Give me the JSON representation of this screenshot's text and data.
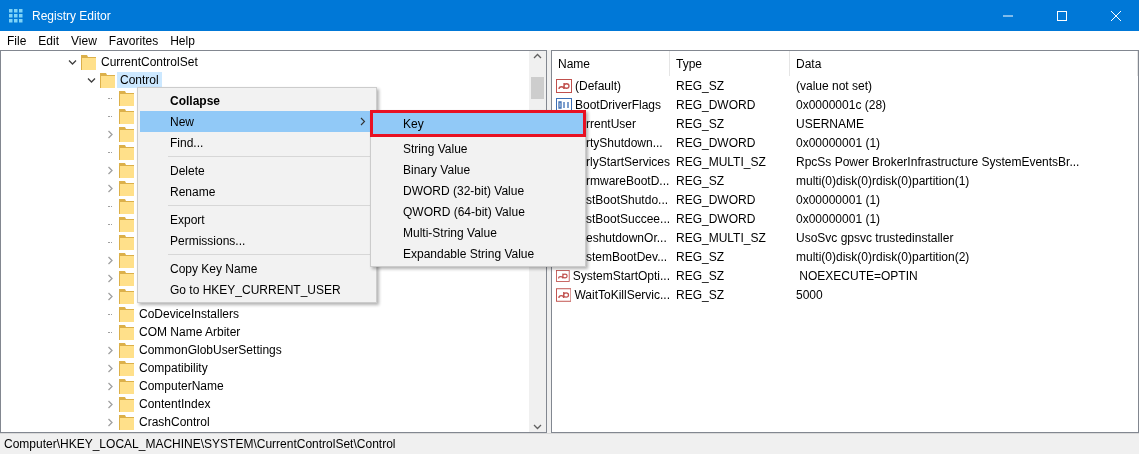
{
  "window": {
    "title": "Registry Editor"
  },
  "menu_bar": [
    "File",
    "Edit",
    "View",
    "Favorites",
    "Help"
  ],
  "tree": [
    {
      "label": "CurrentControlSet",
      "expanded": true,
      "selected": false,
      "children": [
        {
          "label": "Control",
          "expanded": true,
          "selected": true,
          "children": [
            {
              "expandable": false
            },
            {
              "expandable": false
            },
            {
              "expandable": true
            },
            {
              "expandable": false
            },
            {
              "expandable": true
            },
            {
              "expandable": true
            },
            {
              "expandable": false
            },
            {
              "expandable": false
            },
            {
              "expandable": false
            },
            {
              "expandable": true
            },
            {
              "expandable": true
            },
            {
              "expandable": true
            },
            {
              "label": "CoDeviceInstallers",
              "expandable": false
            },
            {
              "label": "COM Name Arbiter",
              "expandable": false
            },
            {
              "label": "CommonGlobUserSettings",
              "expandable": true
            },
            {
              "label": "Compatibility",
              "expandable": true
            },
            {
              "label": "ComputerName",
              "expandable": true
            },
            {
              "label": "ContentIndex",
              "expandable": true
            },
            {
              "label": "CrashControl",
              "expandable": true
            }
          ]
        }
      ]
    }
  ],
  "values": {
    "columns": [
      "Name",
      "Type",
      "Data"
    ],
    "rows": [
      {
        "name": "(Default)",
        "kind": "string",
        "covered": false,
        "type": "REG_SZ",
        "data": "(value not set)"
      },
      {
        "name": "BootDriverFlags",
        "kind": "binary",
        "covered": false,
        "type": "REG_DWORD",
        "data": "0x0000001c (28)"
      },
      {
        "name": "rrentUser",
        "covered": true,
        "type": "REG_SZ",
        "data": "USERNAME"
      },
      {
        "name": "rtyShutdown...",
        "covered": true,
        "type": "REG_DWORD",
        "data": "0x00000001 (1)"
      },
      {
        "name": "rlyStartServices",
        "covered": true,
        "type": "REG_MULTI_SZ",
        "data": "RpcSs Power BrokerInfrastructure SystemEventsBr..."
      },
      {
        "name": "rmwareBootD...",
        "covered": true,
        "type": "REG_SZ",
        "data": "multi(0)disk(0)rdisk(0)partition(1)"
      },
      {
        "name": "stBootShutdo...",
        "covered": true,
        "type": "REG_DWORD",
        "data": "0x00000001 (1)"
      },
      {
        "name": "stBootSuccee...",
        "covered": true,
        "type": "REG_DWORD",
        "data": "0x00000001 (1)"
      },
      {
        "name": "eshutdownOr...",
        "covered": true,
        "type": "REG_MULTI_SZ",
        "data": "UsoSvc gpsvc trustedinstaller"
      },
      {
        "name": "stemBootDev...",
        "covered": true,
        "type": "REG_SZ",
        "data": "multi(0)disk(0)rdisk(0)partition(2)"
      },
      {
        "name": "SystemStartOpti...",
        "kind": "string",
        "covered": false,
        "type": "REG_SZ",
        "data": " NOEXECUTE=OPTIN"
      },
      {
        "name": "WaitToKillServic...",
        "kind": "string",
        "covered": false,
        "type": "REG_SZ",
        "data": "5000"
      }
    ]
  },
  "context_menu": [
    {
      "kind": "item",
      "label": "Collapse",
      "default": true,
      "selected": false
    },
    {
      "kind": "item",
      "label": "New",
      "submenu": true,
      "selected": true
    },
    {
      "kind": "item",
      "label": "Find...",
      "selected": false
    },
    {
      "kind": "separator"
    },
    {
      "kind": "item",
      "label": "Delete",
      "selected": false
    },
    {
      "kind": "item",
      "label": "Rename",
      "selected": false
    },
    {
      "kind": "separator"
    },
    {
      "kind": "item",
      "label": "Export",
      "selected": false
    },
    {
      "kind": "item",
      "label": "Permissions...",
      "selected": false
    },
    {
      "kind": "separator"
    },
    {
      "kind": "item",
      "label": "Copy Key Name",
      "selected": false
    },
    {
      "kind": "item",
      "label": "Go to HKEY_CURRENT_USER",
      "selected": false
    }
  ],
  "submenu": [
    {
      "kind": "item",
      "label": "Key",
      "selected": true,
      "outlined": true
    },
    {
      "kind": "separator"
    },
    {
      "kind": "item",
      "label": "String Value",
      "selected": false,
      "outlined": false
    },
    {
      "kind": "item",
      "label": "Binary Value",
      "selected": false,
      "outlined": false
    },
    {
      "kind": "item",
      "label": "DWORD (32-bit) Value",
      "selected": false,
      "outlined": false
    },
    {
      "kind": "item",
      "label": "QWORD (64-bit) Value",
      "selected": false,
      "outlined": false
    },
    {
      "kind": "item",
      "label": "Multi-String Value",
      "selected": false,
      "outlined": false
    },
    {
      "kind": "item",
      "label": "Expandable String Value",
      "selected": false,
      "outlined": false
    }
  ],
  "status_bar": "Computer\\HKEY_LOCAL_MACHINE\\SYSTEM\\CurrentControlSet\\Control"
}
